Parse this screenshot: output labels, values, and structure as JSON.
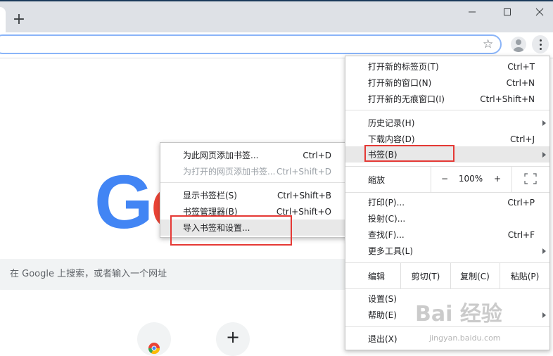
{
  "tabstrip": {
    "new_tab": "+"
  },
  "window_controls": {
    "minimize": "minimize-icon",
    "maximize": "maximize-icon",
    "close": "close-icon"
  },
  "toolbar": {
    "star_icon": "☆"
  },
  "page": {
    "logo_g": "G",
    "logo_o": "o",
    "search_placeholder": "在 Google 上搜索，或者输入一个网址",
    "shortcut_add": "+"
  },
  "main_menu": {
    "items": [
      {
        "label": "打开新的标签页(T)",
        "shortcut": "Ctrl+T"
      },
      {
        "label": "打开新的窗口(N)",
        "shortcut": "Ctrl+N"
      },
      {
        "label": "打开新的无痕窗口(I)",
        "shortcut": "Ctrl+Shift+N"
      },
      {
        "label": "历史记录(H)",
        "shortcut": ""
      },
      {
        "label": "下载内容(D)",
        "shortcut": "Ctrl+J"
      },
      {
        "label": "书签(B)",
        "shortcut": ""
      },
      {
        "label": "打印(P)...",
        "shortcut": "Ctrl+P"
      },
      {
        "label": "投射(C)...",
        "shortcut": ""
      },
      {
        "label": "查找(F)...",
        "shortcut": "Ctrl+F"
      },
      {
        "label": "更多工具(L)",
        "shortcut": ""
      },
      {
        "label": "设置(S)",
        "shortcut": ""
      },
      {
        "label": "帮助(E)",
        "shortcut": ""
      },
      {
        "label": "退出(X)",
        "shortcut": ""
      }
    ],
    "zoom": {
      "label": "缩放",
      "minus": "−",
      "value": "100%",
      "plus": "+"
    },
    "edit": {
      "label": "编辑",
      "cut": "剪切(T)",
      "copy": "复制(C)",
      "paste": "粘贴(P)"
    }
  },
  "bookmarks_menu": {
    "items": [
      {
        "label": "为此网页添加书签...",
        "shortcut": "Ctrl+D"
      },
      {
        "label": "为打开的网页添加书签...",
        "shortcut": "Ctrl+Shift+D"
      },
      {
        "label": "显示书签栏(S)",
        "shortcut": "Ctrl+Shift+B"
      },
      {
        "label": "书签管理器(B)",
        "shortcut": "Ctrl+Shift+O"
      },
      {
        "label": "导入书签和设置...",
        "shortcut": ""
      }
    ]
  },
  "watermark": {
    "text": "Bai 经验",
    "sub": "jingyan.baidu.com"
  },
  "colors": {
    "highlight_box": "#e53935",
    "focus_ring": "#8ab4f8",
    "google_blue": "#4285f4",
    "google_red": "#ea4335"
  }
}
